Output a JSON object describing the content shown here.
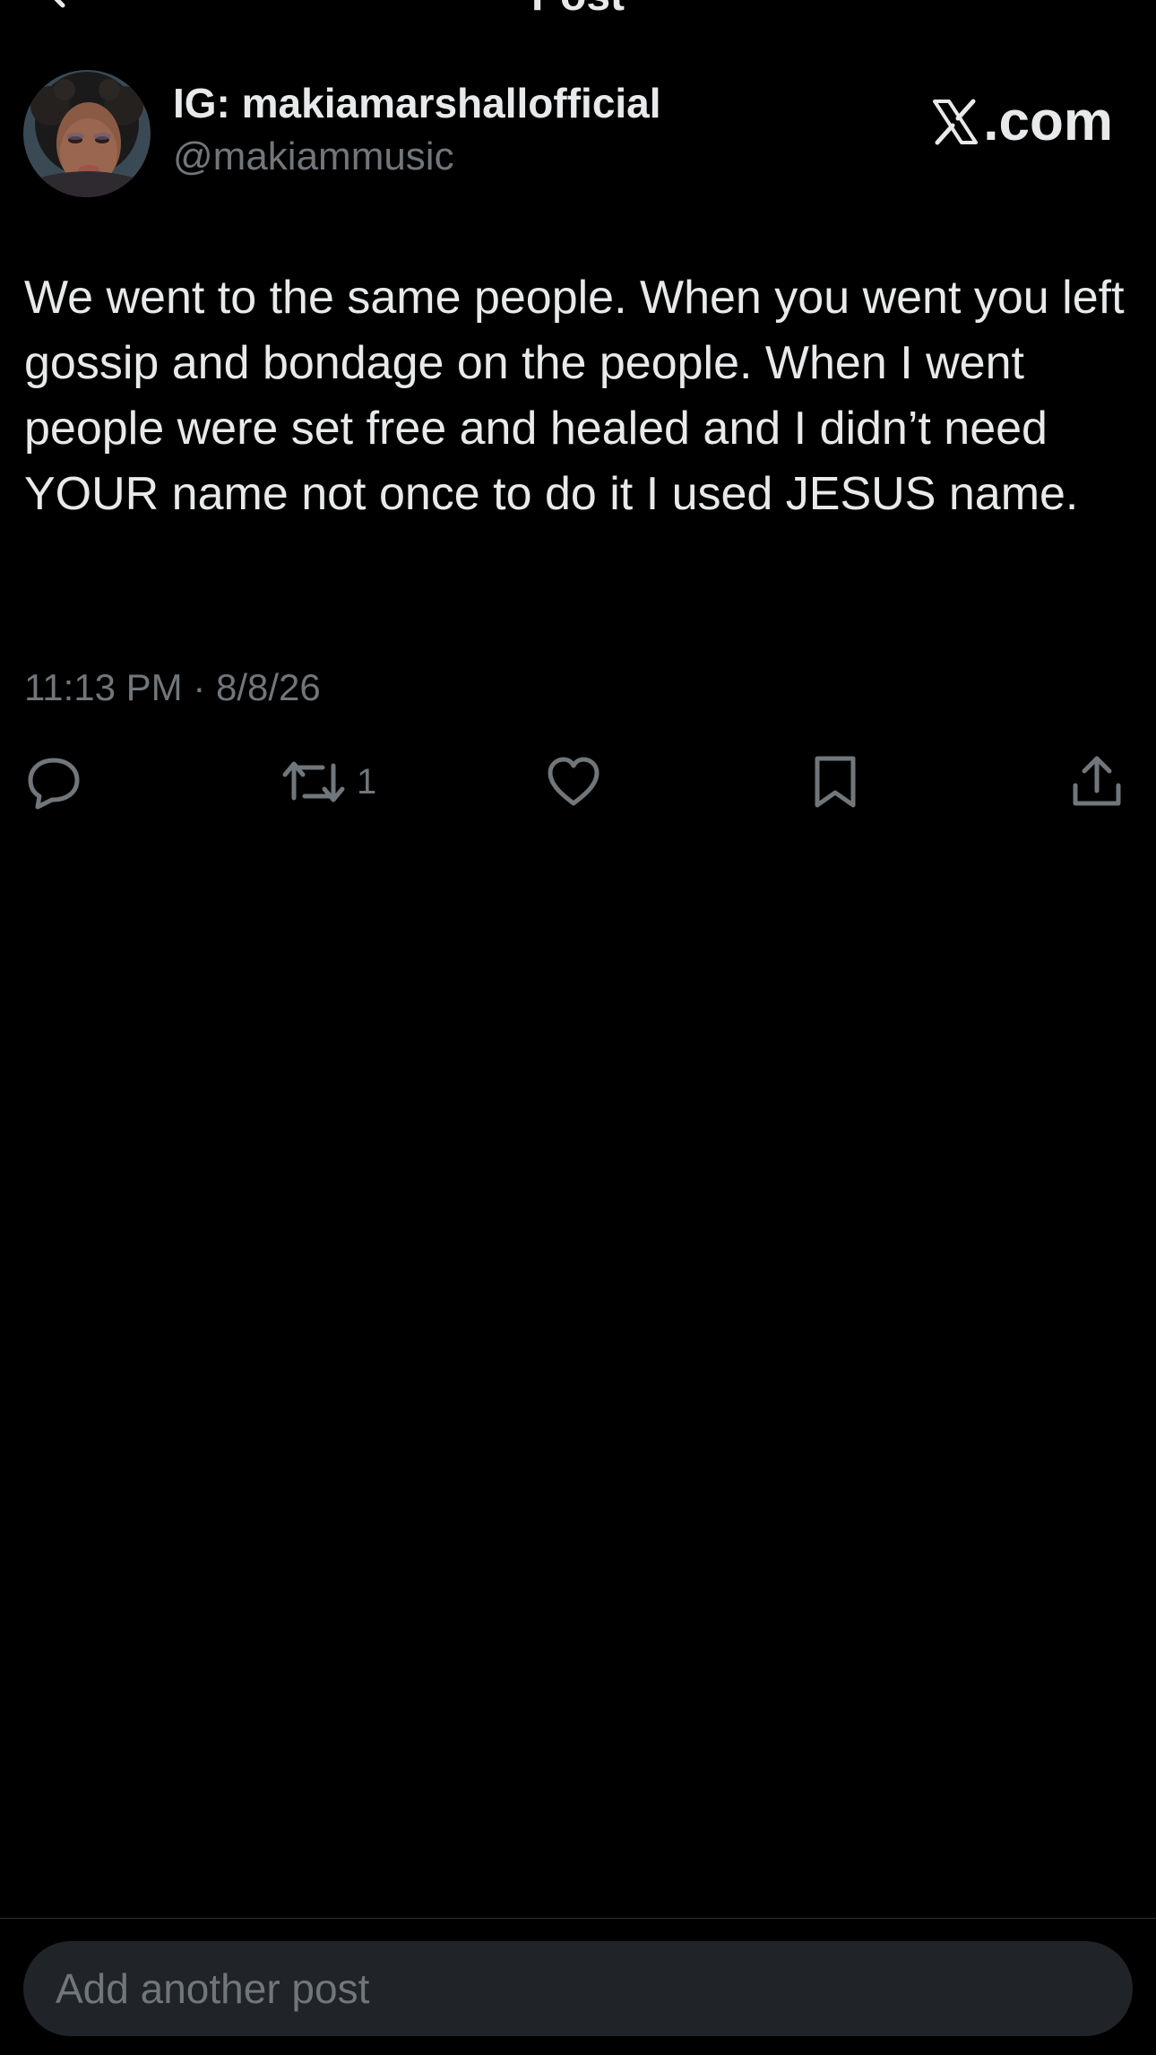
{
  "header": {
    "title": "Post",
    "back_icon": "back-arrow-icon"
  },
  "author": {
    "display_name": "IG: makiamarshallofficial",
    "handle": "@makiammusic",
    "avatar": "profile-photo"
  },
  "brand": {
    "label": ".com",
    "icon": "x-logo-icon"
  },
  "post": {
    "text": "We went to the same people. When you went you left gossip and bondage on the people. When I went people were set free and healed and I didn’t need YOUR name not once to do it I used JESUS name.",
    "timestamp": "11:13 PM · 8/8/26"
  },
  "actions": {
    "reply_icon": "reply-icon",
    "repost_icon": "repost-icon",
    "repost_count": "1",
    "like_icon": "heart-icon",
    "bookmark_icon": "bookmark-icon",
    "share_icon": "share-icon"
  },
  "composer": {
    "placeholder": "Add another post",
    "value": ""
  },
  "colors": {
    "background": "#000000",
    "primary_text": "#e7e9ea",
    "secondary_text": "#71767b",
    "composer_bg": "#202327"
  }
}
